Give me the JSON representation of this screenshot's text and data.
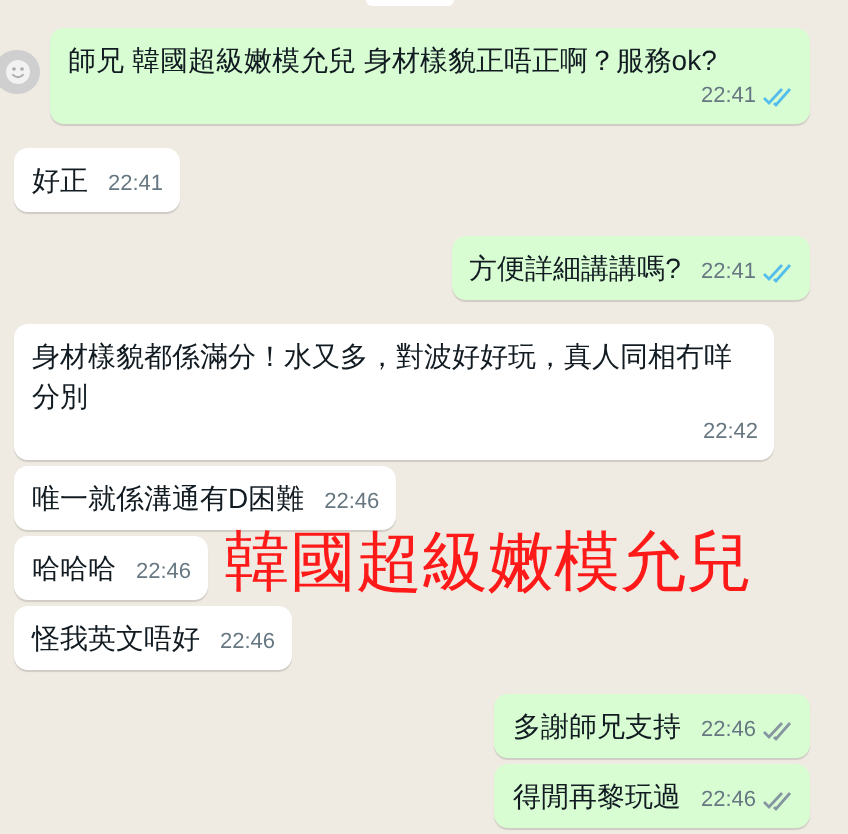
{
  "messages": [
    {
      "outgoing": true,
      "text": "師兄 韓國超級嫩模允兒 身材樣貌正唔正啊？服務ok?",
      "time": "22:41",
      "read": true
    },
    {
      "outgoing": false,
      "text": "好正",
      "time": "22:41"
    },
    {
      "outgoing": true,
      "text": "方便詳細講講嗎?",
      "time": "22:41",
      "read": true
    },
    {
      "outgoing": false,
      "text": "身材樣貌都係滿分！水又多，對波好好玩，真人同相冇咩分別",
      "time": "22:42"
    },
    {
      "outgoing": false,
      "text": "唯一就係溝通有D困難",
      "time": "22:46"
    },
    {
      "outgoing": false,
      "text": "哈哈哈",
      "time": "22:46"
    },
    {
      "outgoing": false,
      "text": "怪我英文唔好",
      "time": "22:46"
    },
    {
      "outgoing": true,
      "text": "多謝師兄支持",
      "time": "22:46",
      "read": false
    },
    {
      "outgoing": true,
      "text": "得閒再黎玩過",
      "time": "22:46",
      "read": false
    }
  ],
  "overlay_caption": "韓國超級嫩模允兒"
}
